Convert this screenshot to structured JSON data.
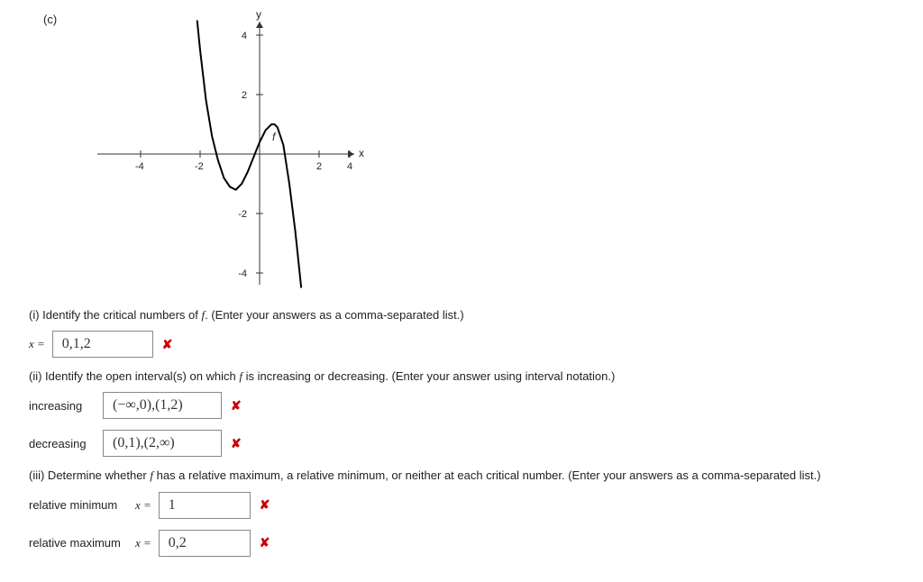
{
  "part_label": "(c)",
  "graph": {
    "y_axis_label": "y",
    "x_axis_label": "x",
    "curve_label": "f '",
    "x_ticks": [
      "-4",
      "-2",
      "2",
      "4"
    ],
    "y_ticks": [
      "4",
      "2",
      "-2",
      "-4"
    ]
  },
  "q1": {
    "prompt_pre": "(i) Identify the critical numbers of ",
    "prompt_f": "f",
    "prompt_post": ". (Enter your answers as a comma-separated list.)",
    "var_label": "x =",
    "value": "0,1,2"
  },
  "q2": {
    "prompt_pre": "(ii) Identify the open interval(s) on which ",
    "prompt_f": "f",
    "prompt_post": " is increasing or decreasing. (Enter your answer using interval notation.)",
    "increasing_label": "increasing",
    "increasing_value": "(−∞,0),(1,2)",
    "decreasing_label": "decreasing",
    "decreasing_value": "(0,1),(2,∞)"
  },
  "q3": {
    "prompt_pre": "(iii) Determine whether ",
    "prompt_f": "f",
    "prompt_post": " has a relative maximum, a relative minimum, or neither at each critical number. (Enter your answers as a comma-separated list.)",
    "relmin_label": "relative minimum",
    "relmax_label": "relative maximum",
    "var_label": "x =",
    "relmin_value": "1",
    "relmax_value": "0,2"
  },
  "wrong_mark": "✘",
  "chart_data": {
    "type": "line",
    "title": "",
    "xlabel": "x",
    "ylabel": "y",
    "curve_name": "f '",
    "xlim": [
      -5,
      5
    ],
    "ylim": [
      -4.5,
      4.5
    ],
    "x_ticks": [
      -4,
      -2,
      2,
      4
    ],
    "y_ticks": [
      -4,
      -2,
      2,
      4
    ],
    "x": [
      -2.1,
      -2.0,
      -1.8,
      -1.6,
      -1.4,
      -1.2,
      -1.0,
      -0.8,
      -0.6,
      -0.4,
      -0.2,
      0.0,
      0.2,
      0.4,
      0.5,
      0.6,
      0.8,
      1.0,
      1.2,
      1.4
    ],
    "y": [
      4.5,
      3.5,
      1.8,
      0.6,
      -0.2,
      -0.8,
      -1.1,
      -1.2,
      -1.0,
      -0.6,
      -0.1,
      0.4,
      0.8,
      1.0,
      1.0,
      0.9,
      0.3,
      -1.0,
      -2.6,
      -4.5
    ],
    "zeros_of_fprime": [
      "≈ -1.4",
      "≈ -0.2",
      "≈ 0.9"
    ]
  }
}
